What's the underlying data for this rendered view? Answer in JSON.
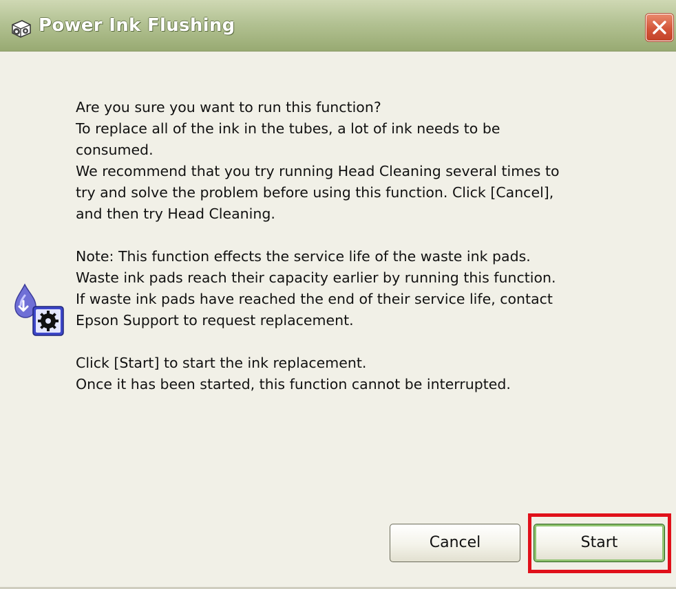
{
  "window": {
    "title": "Power Ink Flushing",
    "title_icon": "printer-gear-icon",
    "close_icon": "close-icon"
  },
  "content": {
    "side_icon": "ink-drop-gear-icon",
    "lines": [
      "Are you sure you want to run this function?",
      "To replace all of the ink in the tubes, a lot of ink needs to be",
      "consumed.",
      "We recommend that you try running Head Cleaning several times to",
      "try and solve the problem before using this function. Click [Cancel],",
      "and then try Head Cleaning.",
      "Note: This function effects the service life of the waste ink pads.",
      "Waste ink pads reach their capacity earlier by running this function.",
      "If waste ink pads have reached the end of their service life, contact",
      "Epson Support to request replacement.",
      "Click [Start] to start the ink replacement.",
      "Once it has been started, this function cannot be interrupted."
    ]
  },
  "buttons": {
    "cancel_label": "Cancel",
    "start_label": "Start"
  },
  "colors": {
    "titlebar": "#b3c293",
    "close_button": "#d4563a",
    "highlight": "#e0101a",
    "background": "#f1f0e7"
  }
}
